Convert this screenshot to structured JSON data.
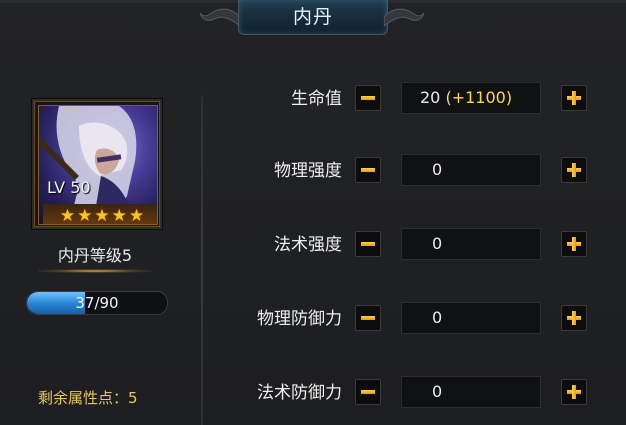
{
  "window": {
    "title": "内丹"
  },
  "hero": {
    "level_label": "LV 50",
    "stars": 5,
    "icons": [
      "star-icon"
    ]
  },
  "neidan": {
    "level_text": "内丹等级5",
    "exp_text": "37/90",
    "exp_current": 37,
    "exp_max": 90
  },
  "remaining_points_text": "剩余属性点：5",
  "stats": [
    {
      "label": "生命值",
      "value": "20",
      "bonus": "(+1100)"
    },
    {
      "label": "物理强度",
      "value": "0",
      "bonus": ""
    },
    {
      "label": "法术强度",
      "value": "0",
      "bonus": ""
    },
    {
      "label": "物理防御力",
      "value": "0",
      "bonus": ""
    },
    {
      "label": "法术防御力",
      "value": "0",
      "bonus": ""
    }
  ],
  "colors": {
    "accent_orange": "#ffb020",
    "bonus_yellow": "#ffd84d",
    "points_gold": "#e8c75a",
    "exp_blue": "#2a86d6",
    "title_blue": "#1f3d4f"
  }
}
